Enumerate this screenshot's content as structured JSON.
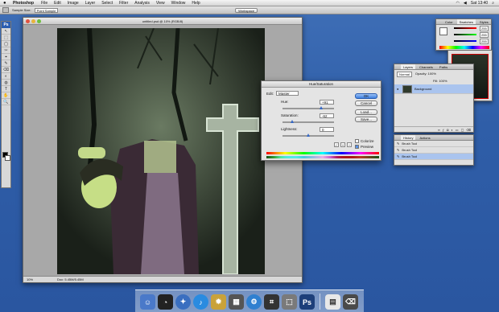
{
  "menubar": {
    "apple": "",
    "app_name": "Photoshop",
    "items": [
      "File",
      "Edit",
      "Image",
      "Layer",
      "Select",
      "Filter",
      "Analysis",
      "View",
      "Window",
      "Help"
    ],
    "clock": "Sat 13:40"
  },
  "options_bar": {
    "sample_label": "Sample Size:",
    "sample_value": "Point Sample",
    "workspace_button": "Workspace"
  },
  "toolbox": {
    "logo": "Ps",
    "tools": [
      "↖",
      "⬚",
      "◯",
      "✂",
      "⌖",
      "✎",
      "⌫",
      "◐",
      "◍",
      "T",
      "✋",
      "🔍"
    ]
  },
  "document": {
    "title": "untitled.psd @ 10% (RGB/8)",
    "zoom": "10%",
    "doc_info": "Doc: 5.45M/5.45M"
  },
  "hue_sat": {
    "title": "Hue/Saturation",
    "edit_label": "Edit:",
    "edit_value": "Master",
    "hue_label": "Hue:",
    "hue_value": "+91",
    "saturation_label": "Saturation:",
    "saturation_value": "-62",
    "lightness_label": "Lightness:",
    "lightness_value": "0",
    "ok": "OK",
    "cancel": "Cancel",
    "load": "Load...",
    "save": "Save...",
    "colorize": "Colorize",
    "preview": "Preview",
    "hue_level": 0.75,
    "saturation_level": 0.19,
    "lightness_level": 0.5
  },
  "color_palette": {
    "tabs": [
      "Color",
      "Swatches",
      "Styles"
    ],
    "r": "255",
    "g": "255",
    "b": "255"
  },
  "layers_palette": {
    "tabs": [
      "Layers",
      "Channels",
      "Paths"
    ],
    "mode": "Normal",
    "opacity": "Opacity: 100%",
    "fill": "Fill: 100%",
    "layer_name": "Background"
  },
  "actions_palette": {
    "tabs": [
      "History",
      "Actions"
    ],
    "items": [
      "Brush Tool",
      "Brush Tool",
      "Brush Tool"
    ]
  },
  "colors": {
    "ok_blue": "#3d7fe0",
    "desktop": "#2f5ea8"
  }
}
